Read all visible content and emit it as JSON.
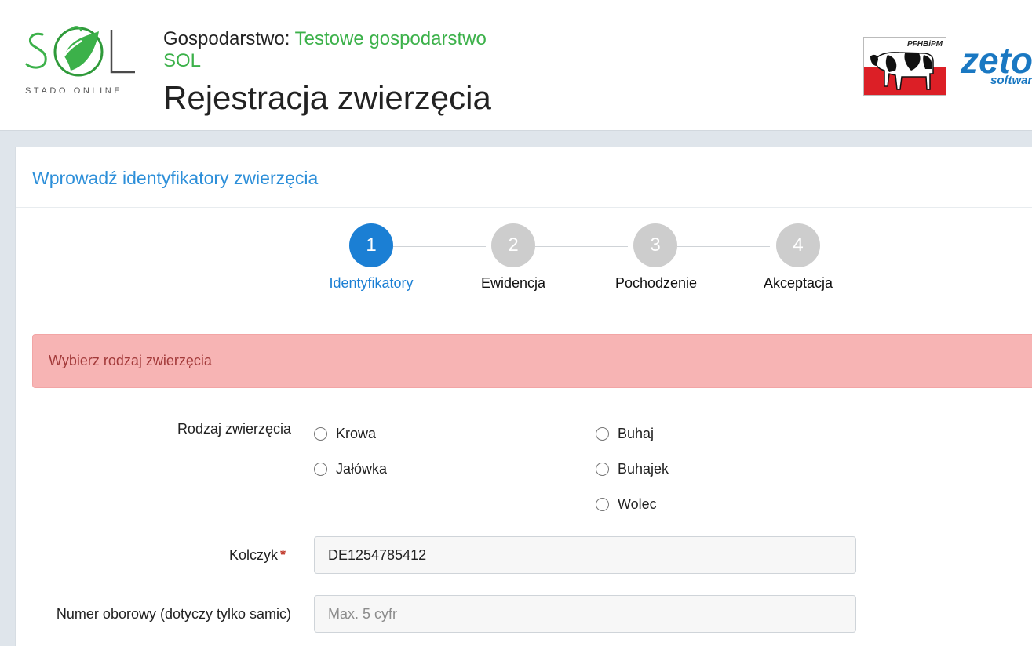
{
  "header": {
    "logo_text": "SOL",
    "logo_subtitle": "STADO ONLINE",
    "farm_label": "Gospodarstwo:",
    "farm_name": "Testowe gospodarstwo SOL",
    "page_title": "Rejestracja zwierzęcia",
    "partner_logo_text": "PFHBiPM",
    "zeto_logo_text": "zeto",
    "zeto_logo_sub": "software"
  },
  "panel": {
    "title": "Wprowadź identyfikatory zwierzęcia"
  },
  "steps": [
    {
      "number": "1",
      "label": "Identyfikatory",
      "active": true
    },
    {
      "number": "2",
      "label": "Ewidencja",
      "active": false
    },
    {
      "number": "3",
      "label": "Pochodzenie",
      "active": false
    },
    {
      "number": "4",
      "label": "Akceptacja",
      "active": false
    }
  ],
  "alert": {
    "text": "Wybierz rodzaj zwierzęcia"
  },
  "form": {
    "animal_type": {
      "label": "Rodzaj zwierzęcia",
      "options": [
        "Krowa",
        "Jałówka",
        "Buhaj",
        "Buhajek",
        "Wolec"
      ]
    },
    "ear_tag": {
      "label": "Kolczyk",
      "required_mark": "*",
      "value": "DE1254785412"
    },
    "herd_number": {
      "label": "Numer oborowy (dotyczy tylko samic)",
      "placeholder": "Max. 5 cyfr"
    }
  },
  "colors": {
    "accent": "#1b7fd4",
    "farm_name": "#3cb14a",
    "alert_bg": "#f7b4b4",
    "alert_text": "#a33a3a"
  }
}
